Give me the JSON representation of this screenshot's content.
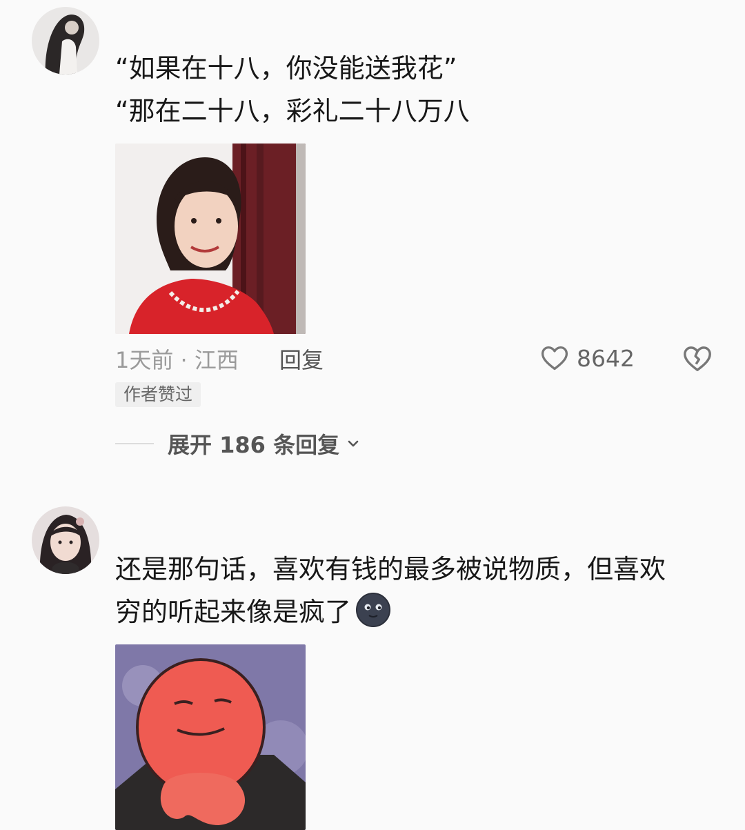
{
  "comment1": {
    "lines": [
      "“如果在十八，你没能送我花”",
      "“那在二十八，彩礼二十八万八"
    ],
    "meta": "1天前 · 江西",
    "reply_label": "回复",
    "likes": "8642",
    "badge": "作者赞过",
    "expand_label": "展开 186 条回复"
  },
  "comment2": {
    "lines": [
      "还是那句话，喜欢有钱的最多被说物质，但喜欢",
      "穷的听起来像是疯了"
    ]
  },
  "icons": {
    "like": "heart-outline-icon",
    "dislike": "broken-heart-icon",
    "expand": "chevron-down-icon",
    "emoji": "dark-moon-face-emoji"
  },
  "colors": {
    "accent_red": "#d8232a",
    "meta_gray": "#9a9a9a"
  }
}
